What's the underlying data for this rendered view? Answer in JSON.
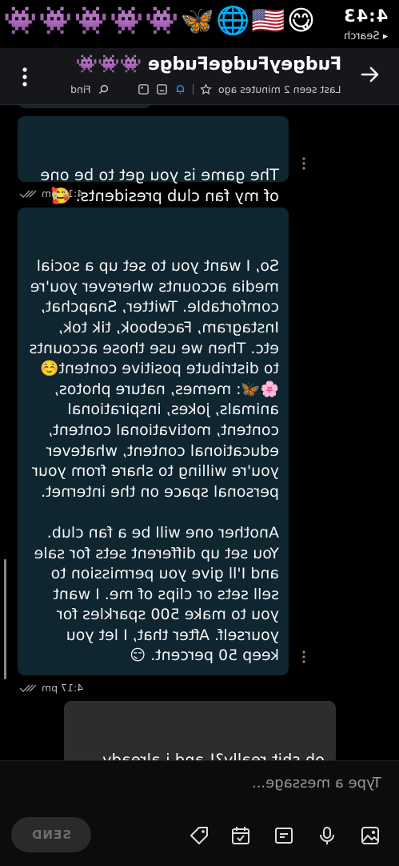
{
  "status_bar": {
    "time": "4:43",
    "back_label": "◂ Search",
    "icons": [
      "👾",
      "👾",
      "👾",
      "👾",
      "👾",
      "🦋",
      "🌐",
      "🇺🇸",
      "😋"
    ]
  },
  "header": {
    "name": "FudgeyFudgeFudge 👾👾👾",
    "last_seen": "Last seen 2 minutes ago",
    "find_label": "Find"
  },
  "messages": [
    {
      "direction": "incoming",
      "text": "The game is you get to be one of my fan club presidents. 🥰",
      "time": "4:11 pm"
    },
    {
      "direction": "incoming",
      "text": "So, I want you to set up a social media accounts wherever you're comfortable. Twitter, Snapchat, Instagram, Facebook, tik tok, etc. Then we use those accounts to distribute positive content☺️🌸🦋: memes, nature photos, animals, jokes, inspirational content, motivational content, educational content, whatever you're willing to share from your personal space on the internet.\n\nAnother one will be a fan club. You set up different sets for sale and I'll give you permission to sell sets or clips of me. I want you to make 500 sparkles for yourself. After that, I let you keep 50 percent. 😏",
      "time": "4:17 pm"
    },
    {
      "direction": "outgoing",
      "text": "oh shit really?! and i already had made a snapchat for you recent-\nly hahaha but i need some stuff"
    }
  ],
  "composer": {
    "placeholder": "Type a message...",
    "send_label": "SEND",
    "icons": [
      "image-icon",
      "mic-icon",
      "gif-icon",
      "calendar-icon",
      "tag-icon"
    ]
  }
}
